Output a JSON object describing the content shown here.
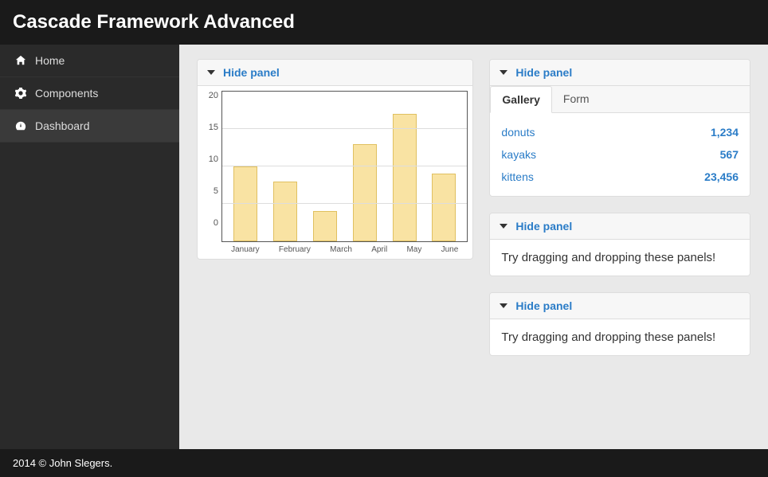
{
  "app_title": "Cascade Framework Advanced",
  "sidebar": {
    "items": [
      {
        "label": "Home",
        "icon": "home-icon"
      },
      {
        "label": "Components",
        "icon": "gear-icon"
      },
      {
        "label": "Dashboard",
        "icon": "dashboard-icon",
        "active": true
      }
    ]
  },
  "panels": {
    "hide_label": "Hide panel",
    "drag_text": "Try dragging and dropping these panels!"
  },
  "tabs": [
    {
      "label": "Gallery",
      "active": true
    },
    {
      "label": "Form"
    }
  ],
  "gallery": [
    {
      "name": "donuts",
      "value": "1,234"
    },
    {
      "name": "kayaks",
      "value": "567"
    },
    {
      "name": "kittens",
      "value": "23,456"
    }
  ],
  "footer": "2014 © John Slegers.",
  "chart_data": {
    "type": "bar",
    "categories": [
      "January",
      "February",
      "March",
      "April",
      "May",
      "June"
    ],
    "values": [
      10,
      8,
      4,
      13,
      17,
      9
    ],
    "title": "",
    "xlabel": "",
    "ylabel": "",
    "ylim": [
      0,
      20
    ],
    "yticks": [
      0,
      5,
      10,
      15,
      20
    ],
    "bar_color": "#f9e3a3",
    "bar_border": "#e0c060"
  }
}
